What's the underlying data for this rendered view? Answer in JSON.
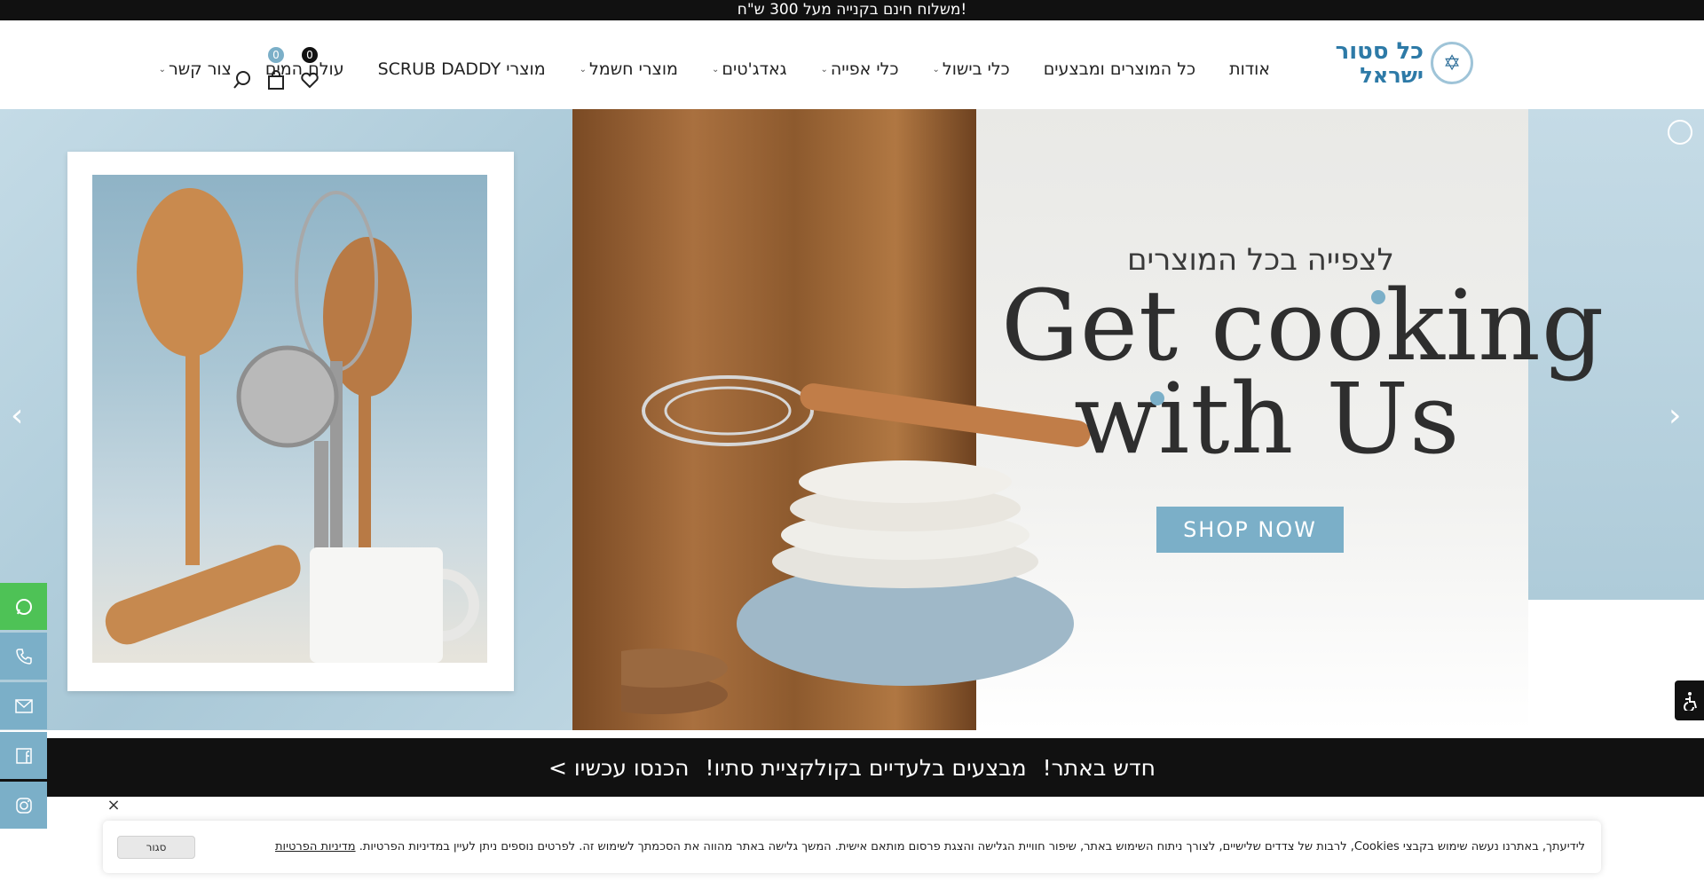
{
  "topbar": {
    "text": "משלוח חינם בקנייה מעל 300 ש\"ח!"
  },
  "logo": {
    "line1": "כל סטור",
    "line2": "ישראל",
    "star": "✡"
  },
  "nav": {
    "items": [
      {
        "label": "אודות",
        "dropdown": false
      },
      {
        "label": "כל המוצרים ומבצעים",
        "dropdown": false
      },
      {
        "label": "כלי בישול",
        "dropdown": true
      },
      {
        "label": "כלי אפייה",
        "dropdown": true
      },
      {
        "label": "גאדג'טים",
        "dropdown": true
      },
      {
        "label": "מוצרי חשמל",
        "dropdown": true
      },
      {
        "label": "מוצרי SCRUB DADDY",
        "dropdown": false
      },
      {
        "label": "עולם המים",
        "dropdown": false
      },
      {
        "label": "צור קשר",
        "dropdown": true
      }
    ]
  },
  "header_icons": {
    "wishlist_count": "0",
    "cart_count": "0"
  },
  "hero": {
    "headline_he": "לצפייה בכל המוצרים",
    "headline_en_line1": "Get cooking",
    "headline_en_line2": "with Us",
    "cta": "SHOP NOW"
  },
  "promo": {
    "part1": "חדש באתר!",
    "part2": "מבצעים בלעדיים בקולקציית סתיו!",
    "part3": "הכנסו עכשיו >"
  },
  "cookie": {
    "text": "לידיעתך, באתרנו נעשה שימוש בקבצי Cookies, לרבות של צדדים שלישיים, לצורך ניתוח השימוש באתר, שיפור חוויית הגלישה והצגת פרסום מותאם אישית. המשך גלישה באתר מהווה את הסכמתך לשימוש זה. לפרטים נוספים ניתן לעיין במדיניות הפרטיות.",
    "link": "מדיניות הפרטיות",
    "button": "סגור"
  },
  "colors": {
    "accent": "#7bafc8",
    "whatsapp": "#4ec256",
    "dark": "#111111"
  }
}
